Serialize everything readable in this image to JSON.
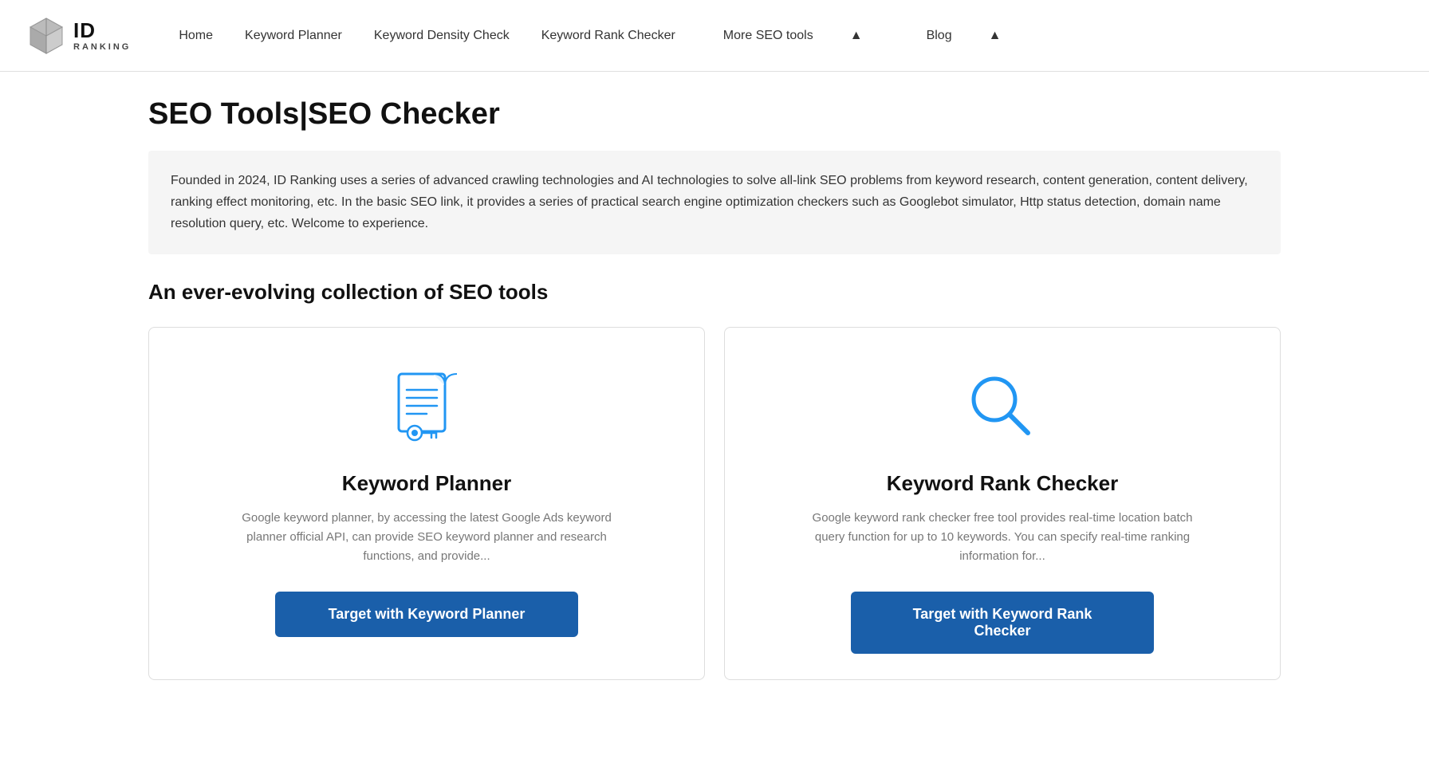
{
  "site": {
    "logo_id": "ID",
    "logo_sub": "RANKING",
    "title": "ID RANKING"
  },
  "nav": {
    "links": [
      {
        "id": "home",
        "label": "Home",
        "has_caret": false
      },
      {
        "id": "keyword-planner",
        "label": "Keyword Planner",
        "has_caret": false
      },
      {
        "id": "keyword-density",
        "label": "Keyword Density Check",
        "has_caret": false
      },
      {
        "id": "keyword-rank",
        "label": "Keyword Rank Checker",
        "has_caret": false
      },
      {
        "id": "more-seo",
        "label": "More SEO tools",
        "has_caret": true
      },
      {
        "id": "blog",
        "label": "Blog",
        "has_caret": true
      }
    ]
  },
  "page": {
    "title": "SEO Tools|SEO Checker",
    "description": "Founded in 2024, ID Ranking uses a series of advanced crawling technologies and AI technologies to solve all-link SEO problems from keyword research, content generation, content delivery, ranking effect monitoring, etc. In the basic SEO link, it provides a series of practical search engine optimization checkers such as Googlebot simulator, Http status detection, domain name resolution query, etc. Welcome to experience.",
    "section_title": "An ever-evolving collection of SEO tools",
    "cards": [
      {
        "id": "keyword-planner",
        "icon_type": "document",
        "title": "Keyword Planner",
        "description": "Google keyword planner, by accessing the latest Google Ads keyword planner official API, can provide SEO keyword planner and research functions, and provide...",
        "button_label": "Target with Keyword Planner"
      },
      {
        "id": "keyword-rank-checker",
        "icon_type": "search",
        "title": "Keyword Rank Checker",
        "description": "Google keyword rank checker free tool provides real-time location batch query function for up to 10 keywords. You can specify real-time ranking information for...",
        "button_label": "Target with Keyword Rank Checker"
      }
    ]
  },
  "colors": {
    "button_bg": "#1a5faa",
    "icon_blue": "#2196F3",
    "icon_blue_light": "#4db6f5"
  }
}
